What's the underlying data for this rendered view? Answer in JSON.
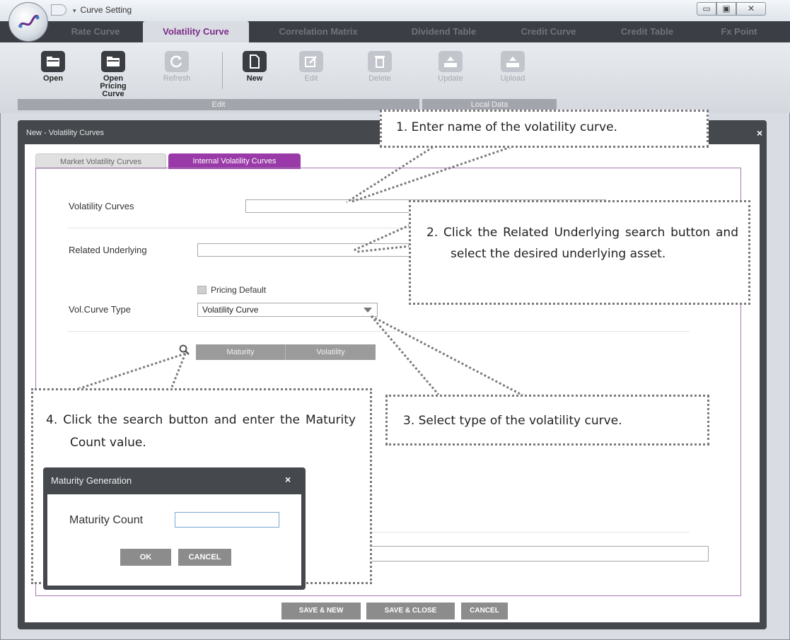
{
  "window": {
    "title": "Curve Setting",
    "quick_access_arrow": "▾",
    "controls": {
      "minimize": "▭",
      "maximize": "▣",
      "close": "✕"
    }
  },
  "ribbon_tabs": [
    {
      "label": "Rate Curve",
      "active": false
    },
    {
      "label": "Volatility Curve",
      "active": true
    },
    {
      "label": "Correlation Matrix",
      "active": false
    },
    {
      "label": "Dividend Table",
      "active": false
    },
    {
      "label": "Credit Curve",
      "active": false
    },
    {
      "label": "Credit Table",
      "active": false
    },
    {
      "label": "Fx Point",
      "active": false
    }
  ],
  "ribbon_buttons": [
    {
      "label": "Open",
      "icon": "folder-icon",
      "enabled": true
    },
    {
      "label": "Open Pricing Curve",
      "icon": "folder-icon",
      "enabled": true
    },
    {
      "label": "Refresh",
      "icon": "refresh-icon",
      "enabled": false
    },
    {
      "label": "New",
      "icon": "new-document-icon",
      "enabled": true
    },
    {
      "label": "Edit",
      "icon": "edit-icon",
      "enabled": false
    },
    {
      "label": "Delete",
      "icon": "delete-icon",
      "enabled": false
    },
    {
      "label": "Update",
      "icon": "update-icon",
      "enabled": false
    },
    {
      "label": "Upload",
      "icon": "upload-icon",
      "enabled": false
    }
  ],
  "ribbon_groups": {
    "edit": "Edit",
    "local_data": "Local Data"
  },
  "dialog": {
    "title": "New - Volatility Curves",
    "close": "×",
    "tabs": [
      {
        "label": "Market Volatility Curves",
        "active": false
      },
      {
        "label": "Internal Volatility Curves",
        "active": true
      }
    ],
    "fields": {
      "volatility_curves_label": "Volatility Curves",
      "volatility_curves_value": "",
      "related_underlying_label": "Related Underlying",
      "related_underlying_value": "",
      "pricing_default_label": "Pricing Default",
      "vol_curve_type_label": "Vol.Curve Type",
      "vol_curve_type_value": "Volatility Curve"
    },
    "grid_columns": [
      "Maturity",
      "Volatility"
    ],
    "footer_buttons": [
      "SAVE & NEW",
      "SAVE & CLOSE",
      "CANCEL"
    ]
  },
  "maturity_popup": {
    "title": "Maturity Generation",
    "close": "×",
    "field_label": "Maturity Count",
    "field_value": "",
    "ok": "OK",
    "cancel": "CANCEL"
  },
  "callouts": {
    "step1": "1.  Enter name of the volatility curve.",
    "step2": "2.  Click the Related Underlying search button and select the desired underlying asset.",
    "step3": "3.  Select type of the volatility curve.",
    "step4": "4.  Click the search button and enter the Maturity Count value."
  },
  "colors": {
    "accent": "#9a3aa8",
    "dark_chrome": "#45484d",
    "tab_active_text": "#7c2c86"
  }
}
